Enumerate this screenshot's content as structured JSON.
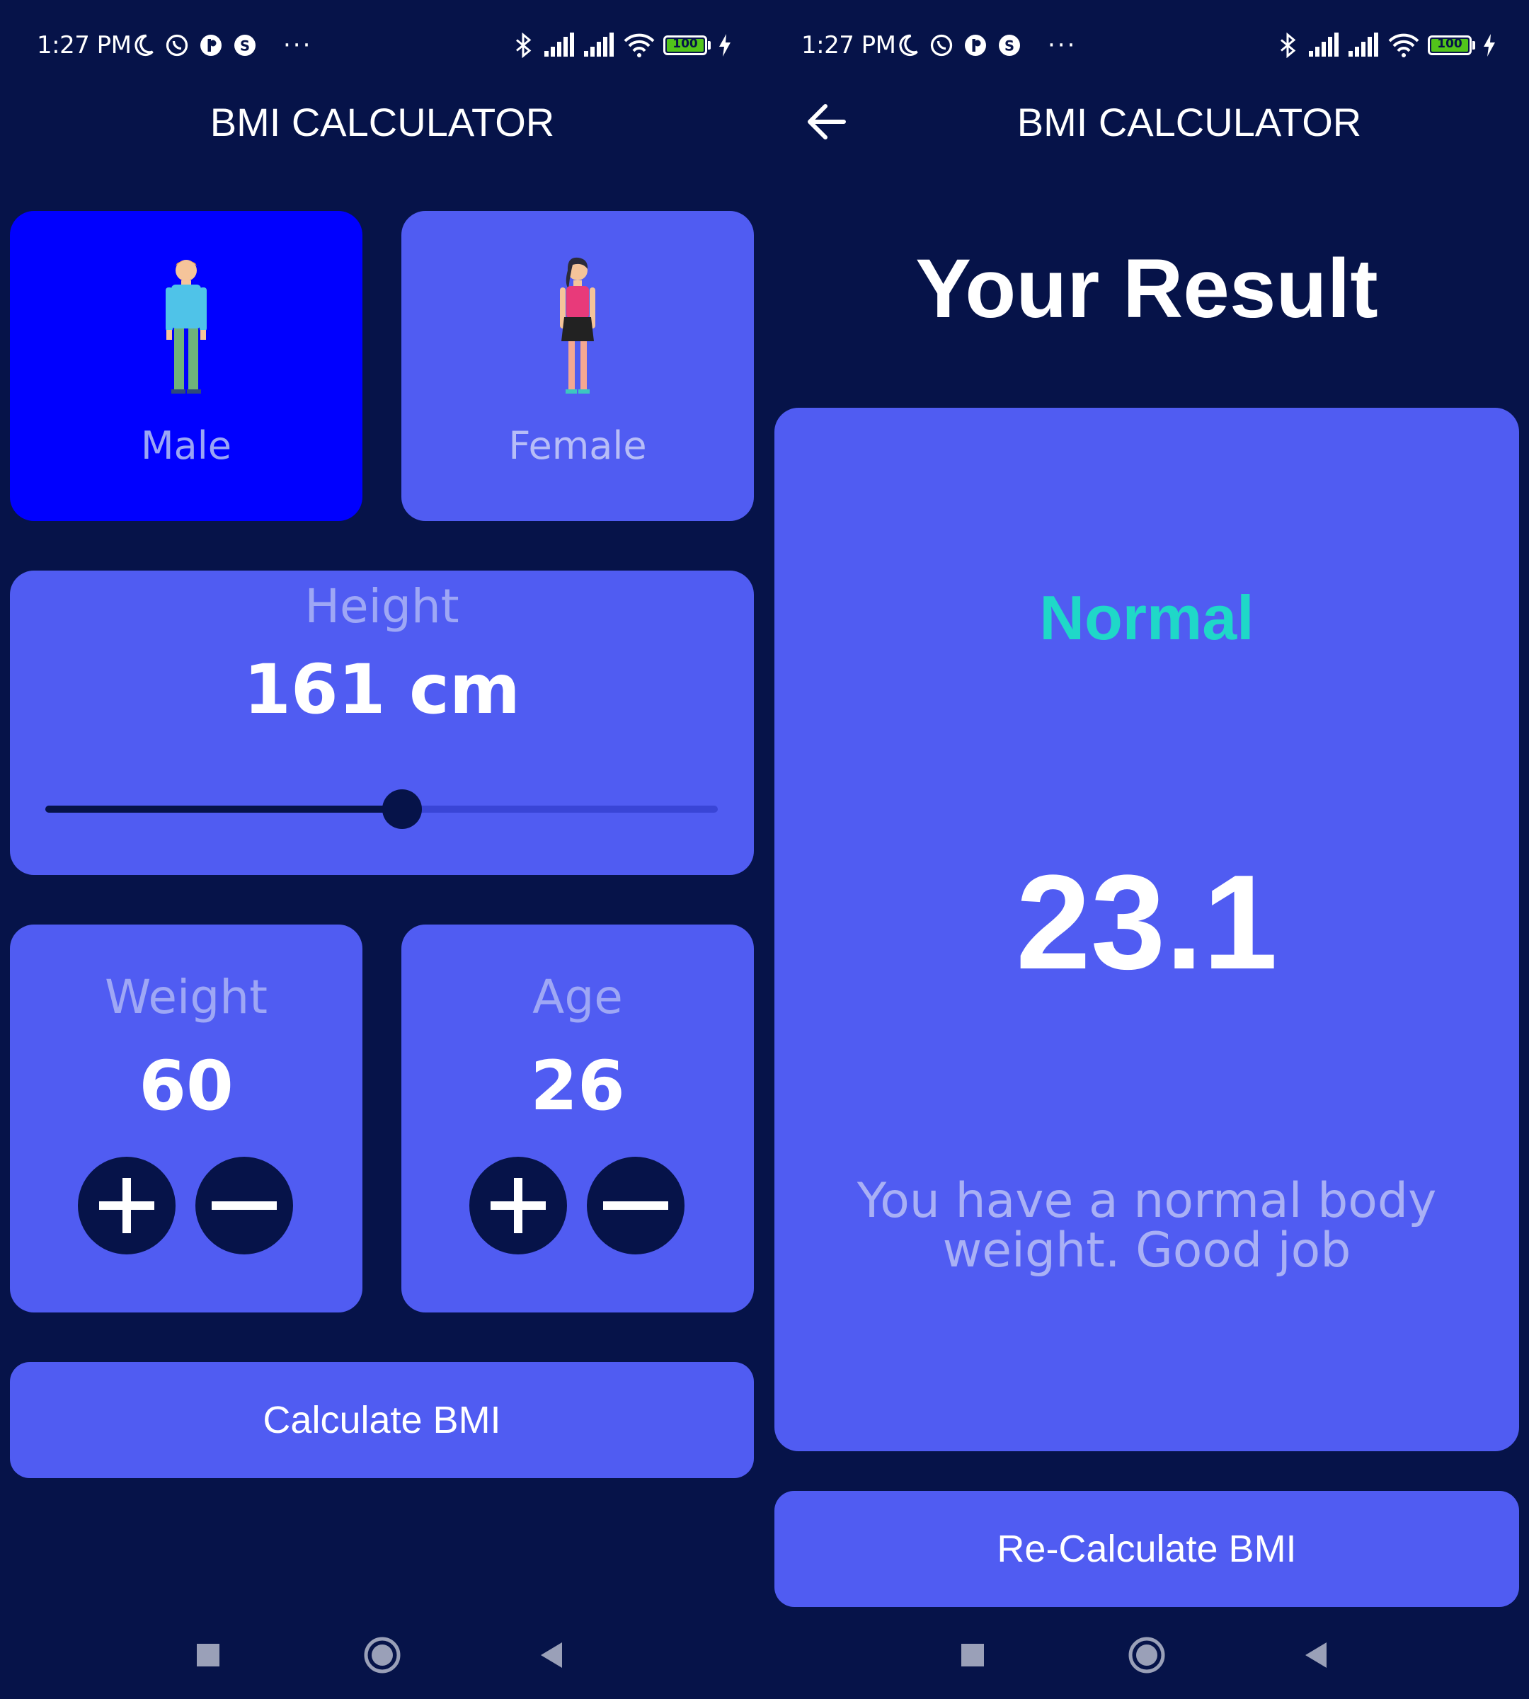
{
  "status_bar": {
    "time": "1:27 PM",
    "battery_level": "100",
    "icons_left": [
      "moon-icon",
      "whatsapp-icon",
      "app-icon",
      "s-icon"
    ],
    "icons_right": [
      "bluetooth-icon",
      "signal-icon",
      "signal-icon",
      "wifi-icon",
      "battery-icon",
      "charging-icon"
    ],
    "overflow": "···"
  },
  "calculator": {
    "title": "BMI CALCULATOR",
    "gender": {
      "male_label": "Male",
      "female_label": "Female",
      "selected": "male"
    },
    "height": {
      "label": "Height",
      "value_text": "161 cm",
      "slider_fraction": 0.53
    },
    "weight": {
      "label": "Weight",
      "value": "60"
    },
    "age": {
      "label": "Age",
      "value": "26"
    },
    "calculate_label": "Calculate BMI"
  },
  "result": {
    "title": "BMI CALCULATOR",
    "heading": "Your Result",
    "status": "Normal",
    "bmi": "23.1",
    "message": "You have a normal body weight. Good job",
    "recalculate_label": "Re-Calculate BMI"
  },
  "colors": {
    "background": "#061349",
    "card": "#505cf2",
    "selected_card": "#0000ff",
    "status_normal": "#1fd8c8"
  }
}
